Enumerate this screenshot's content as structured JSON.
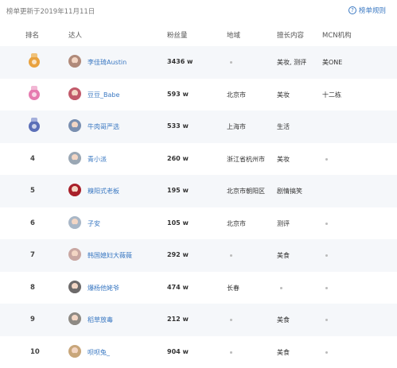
{
  "page": {
    "update_text": "榜单更新于2019年11月11日",
    "rules_icon": "question-circle-icon",
    "rules_label": "榜单规则"
  },
  "table": {
    "headers": {
      "rank": "排名",
      "name": "达人",
      "fans": "粉丝量",
      "region": "地域",
      "tag": "擅长内容",
      "mcn": "MCN机构"
    },
    "rows": [
      {
        "rank": "1",
        "medal": "gold",
        "avatar_color": "#b08a7a",
        "name": "李佳琦Austin",
        "fans": "3436 w",
        "region": "",
        "tag": "美妆, 测评",
        "mcn": "美ONE"
      },
      {
        "rank": "2",
        "medal": "pink",
        "avatar_color": "#c25a6a",
        "name": "豆豆_Babe",
        "fans": "593 w",
        "region": "北京市",
        "tag": "美妆",
        "mcn": "十二栋"
      },
      {
        "rank": "3",
        "medal": "blue",
        "avatar_color": "#7a8fb0",
        "name": "牛肉哥严选",
        "fans": "533 w",
        "region": "上海市",
        "tag": "生活",
        "mcn": ""
      },
      {
        "rank": "4",
        "medal": "",
        "avatar_color": "#9aa7b4",
        "name": "青小派",
        "fans": "260 w",
        "region": "浙江省杭州市",
        "tag": "美妆",
        "mcn": ""
      },
      {
        "rank": "5",
        "medal": "",
        "avatar_color": "#a8202a",
        "name": "糗阳式老板",
        "fans": "195 w",
        "region": "北京市朝阳区",
        "tag": "剧情搞笑",
        "mcn": ""
      },
      {
        "rank": "6",
        "medal": "",
        "avatar_color": "#a9b7c7",
        "name": "子安",
        "fans": "105 w",
        "region": "北京市",
        "tag": "测评",
        "mcn": ""
      },
      {
        "rank": "7",
        "medal": "",
        "avatar_color": "#c9a7a2",
        "name": "韩国媳妇大薇薇",
        "fans": "292 w",
        "region": "",
        "tag": "美食",
        "mcn": ""
      },
      {
        "rank": "8",
        "medal": "",
        "avatar_color": "#6d6a6a",
        "name": "爆杨他姥爷",
        "fans": "474 w",
        "region": "长春",
        "tag": "",
        "mcn": ""
      },
      {
        "rank": "9",
        "medal": "",
        "avatar_color": "#8e8a84",
        "name": "稻草放毒",
        "fans": "212 w",
        "region": "",
        "tag": "美食",
        "mcn": ""
      },
      {
        "rank": "10",
        "medal": "",
        "avatar_color": "#c8a67a",
        "name": "呗呗兔_",
        "fans": "904 w",
        "region": "",
        "tag": "美食",
        "mcn": ""
      }
    ]
  },
  "colors": {
    "link": "#3a78c2",
    "row_shade": "#f5f7fa",
    "empty_dot": "#bbbbbb"
  }
}
